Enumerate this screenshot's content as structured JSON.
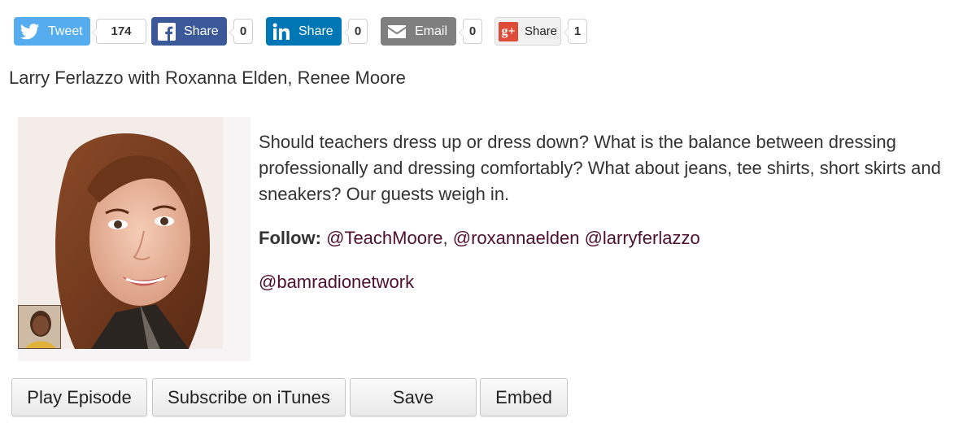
{
  "share_bar": {
    "twitter": {
      "label": "Tweet",
      "count": "174",
      "icon": "twitter-bird-icon",
      "color": "#55acee"
    },
    "facebook": {
      "label": "Share",
      "count": "0",
      "icon": "facebook-icon",
      "color": "#3b5998"
    },
    "linkedin": {
      "label": "Share",
      "count": "0",
      "icon": "linkedin-icon",
      "color": "#0077b5"
    },
    "email": {
      "label": "Email",
      "count": "0",
      "icon": "envelope-icon",
      "color": "#7f7f7f"
    },
    "googleplus": {
      "label": "Share",
      "count": "1",
      "icon": "google-plus-icon",
      "icon_text": "g+",
      "color": "#dd4b39"
    }
  },
  "hosts": "Larry Ferlazzo with Roxanna Elden, Renee Moore",
  "description": "Should teachers dress up or dress down? What is the balance between dressing professionally and dressing comfortably?  What about jeans, tee shirts, short skirts and sneakers? Our guests weigh in.",
  "follow": {
    "label": "Follow:",
    "handle1": "@TeachMoore",
    "sep1": ",",
    "handle2": "@roxannaelden",
    "handle3": "@larryferlazzo"
  },
  "network_handle": "@bamradionetwork",
  "actions": {
    "play": "Play Episode",
    "itunes": "Subscribe on iTunes",
    "save": "Save",
    "embed": "Embed"
  }
}
